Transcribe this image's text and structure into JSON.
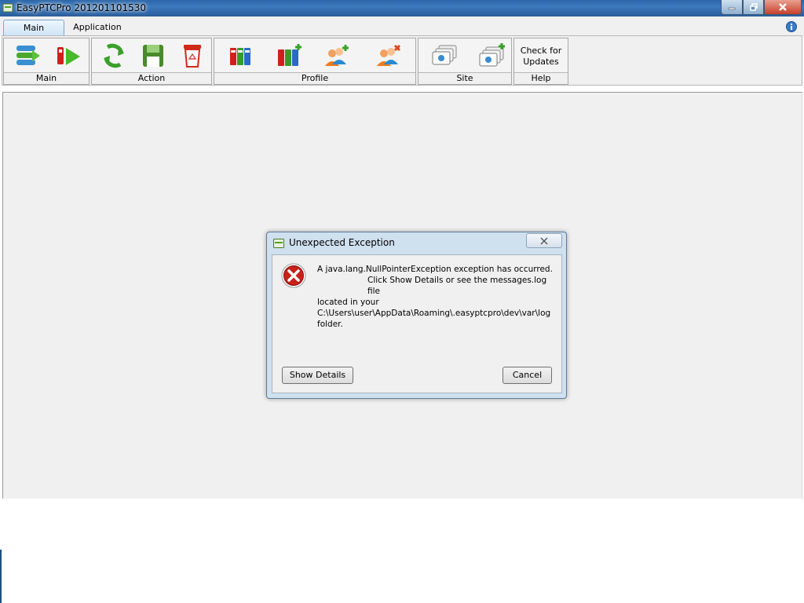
{
  "window": {
    "title": "EasyPTCPro 201201101530"
  },
  "tabs": [
    {
      "label": "Main",
      "selected": true
    },
    {
      "label": "Application",
      "selected": false
    }
  ],
  "ribbon": {
    "groups": {
      "main": {
        "label": "Main",
        "icons": [
          "stack-icon",
          "play-icon"
        ]
      },
      "action": {
        "label": "Action",
        "icons": [
          "refresh-icon",
          "save-icon",
          "trash-icon"
        ]
      },
      "profile": {
        "label": "Profile",
        "icons": [
          "profiles-icon",
          "add-profile-icon",
          "add-user-icon",
          "remove-user-icon"
        ]
      },
      "site": {
        "label": "Site",
        "icons": [
          "sites-icon",
          "add-site-icon"
        ]
      },
      "help": {
        "label": "Help",
        "button_line1": "Check for",
        "button_line2": "Updates"
      }
    }
  },
  "dialog": {
    "title": "Unexpected Exception",
    "message": {
      "line1": "A java.lang.NullPointerException exception has occurred.",
      "line2": "Click Show Details or see the messages.log file",
      "line3": "located in your",
      "line4": "C:\\Users\\user\\AppData\\Roaming\\.easyptcpro\\dev\\var\\log",
      "line5": "folder."
    },
    "show_details_label": "Show Details",
    "cancel_label": "Cancel"
  },
  "colors": {
    "titlebar": "#2e67a8",
    "error_red": "#c8201a",
    "workspace_bg": "#f0f0f0"
  }
}
